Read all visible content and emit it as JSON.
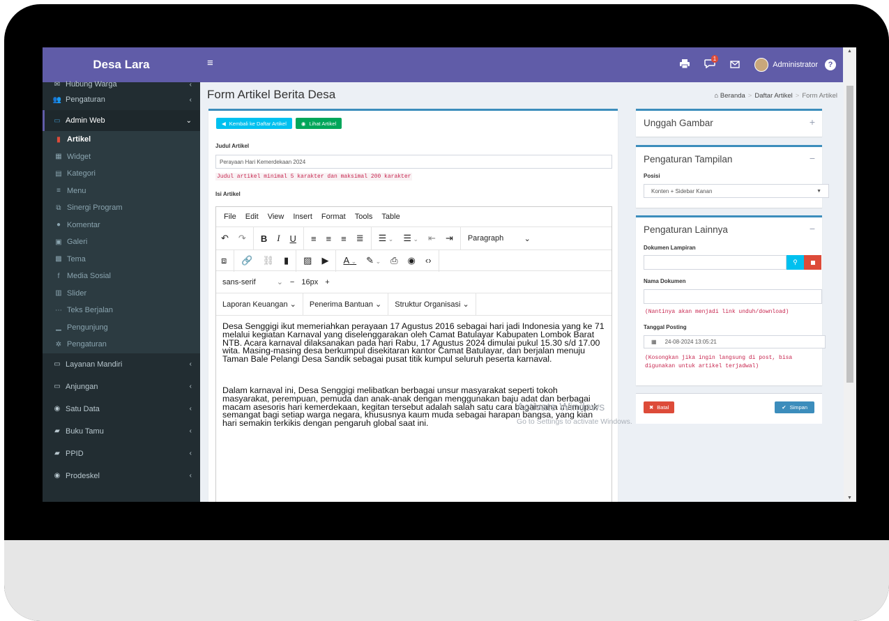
{
  "app": {
    "brand": "Desa Lara"
  },
  "navbar": {
    "hamburger": "≡",
    "notif_count": "1",
    "user_name": "Administrator",
    "help": "?"
  },
  "sidebar": {
    "top_items": [
      {
        "label": "Hubung Warga",
        "icon": "envelope-icon"
      },
      {
        "label": "Pengaturan",
        "icon": "users-cog-icon"
      }
    ],
    "active_section": {
      "label": "Admin Web",
      "icon": "monitor-icon"
    },
    "sub_items": [
      {
        "label": "Artikel",
        "icon": "file-icon"
      },
      {
        "label": "Widget",
        "icon": "grid-icon"
      },
      {
        "label": "Kategori",
        "icon": "list-icon"
      },
      {
        "label": "Menu",
        "icon": "bars-icon"
      },
      {
        "label": "Sinergi Program",
        "icon": "copy-icon"
      },
      {
        "label": "Komentar",
        "icon": "comments-icon"
      },
      {
        "label": "Galeri",
        "icon": "image-icon"
      },
      {
        "label": "Tema",
        "icon": "theme-icon"
      },
      {
        "label": "Media Sosial",
        "icon": "facebook-icon"
      },
      {
        "label": "Slider",
        "icon": "film-icon"
      },
      {
        "label": "Teks Berjalan",
        "icon": "ellipsis-icon"
      },
      {
        "label": "Pengunjung",
        "icon": "chart-icon"
      },
      {
        "label": "Pengaturan",
        "icon": "gear-icon"
      }
    ],
    "bottom_items": [
      {
        "label": "Layanan Mandiri",
        "icon": "laptop-icon"
      },
      {
        "label": "Anjungan",
        "icon": "monitor-icon"
      },
      {
        "label": "Satu Data",
        "icon": "globe-icon"
      },
      {
        "label": "Buku Tamu",
        "icon": "book-icon"
      },
      {
        "label": "PPID",
        "icon": "book-icon"
      },
      {
        "label": "Prodeskel",
        "icon": "globe-icon"
      }
    ]
  },
  "page": {
    "title": "Form Artikel Berita Desa",
    "breadcrumb": [
      "Beranda",
      "Daftar Artikel",
      "Form Artikel"
    ]
  },
  "form": {
    "back_button": "Kembali ke Daftar Artikel",
    "view_button": "Lihat Artikel",
    "title_label": "Judul Artikel",
    "title_value": "Perayaan Hari Kemerdekaan 2024",
    "title_help": "Judul artikel minimal 5 karakter dan maksimal 200 karakter",
    "content_label": "Isi Artikel"
  },
  "editor": {
    "menu": [
      "File",
      "Edit",
      "View",
      "Insert",
      "Format",
      "Tools",
      "Table"
    ],
    "block_format": "Paragraph",
    "font_family": "sans-serif",
    "font_size": "16px",
    "templates": [
      "Laporan Keuangan",
      "Penerima Bantuan",
      "Struktur Organisasi"
    ],
    "paragraphs": [
      "Desa Senggigi ikut memeriahkan perayaan 17 Agustus 2016 sebagai hari jadi Indonesia yang ke 71 melalui kegiatan Karnaval yang diselenggarakan oleh Camat Batulayar Kabupaten Lombok Barat NTB. Acara karnaval dilaksanakan pada hari Rabu, 17 Agustus 2024 dimulai pukul 15.30 s/d 17.00 wita. Masing-masing desa berkumpul disekitaran kantor Camat Batulayar, dan berjalan menuju Taman Bale Pelangi Desa Sandik sebagai pusat titik kumpul seluruh peserta karnaval.",
      "Dalam karnaval ini, Desa Senggigi melibatkan berbagai unsur masyarakat seperti tokoh masyarakat, perempuan, pemuda dan anak-anak dengan menggunakan baju adat dan berbagai macam asesoris hari kemerdekaan, kegitan tersebut adalah salah satu cara bagaimana memupuk semangat bagi setiap warga negara, khususnya kaum muda sebagai harapan bangsa, yang kian hari semakin terkikis dengan pengaruh global saat ini."
    ]
  },
  "upload_box": {
    "title": "Unggah Gambar",
    "tool": "+"
  },
  "display_box": {
    "title": "Pengaturan Tampilan",
    "tool": "−",
    "position_label": "Posisi",
    "position_value": "Konten + Sidebar Kanan"
  },
  "other_box": {
    "title": "Pengaturan Lainnya",
    "tool": "−",
    "doc_label": "Dokumen Lampiran",
    "doc_name_label": "Nama Dokumen",
    "doc_name_help": "(Nantinya akan menjadi link unduh/download)",
    "date_label": "Tanggal Posting",
    "date_value": "24-08-2024 13:05:21",
    "date_help": "(Kosongkan jika ingin langsung di post, bisa digunakan untuk artikel terjadwal)"
  },
  "actions": {
    "cancel": "Batal",
    "save": "Simpan"
  },
  "watermark": {
    "line1": "Activate Windows",
    "line2": "Go to Settings to activate Windows."
  },
  "colors": {
    "brand": "#605ca8",
    "sidebar": "#222d32",
    "info": "#00c0ef",
    "success": "#00a65a",
    "danger": "#dd4b39",
    "box_border": "#3c8dbc"
  }
}
